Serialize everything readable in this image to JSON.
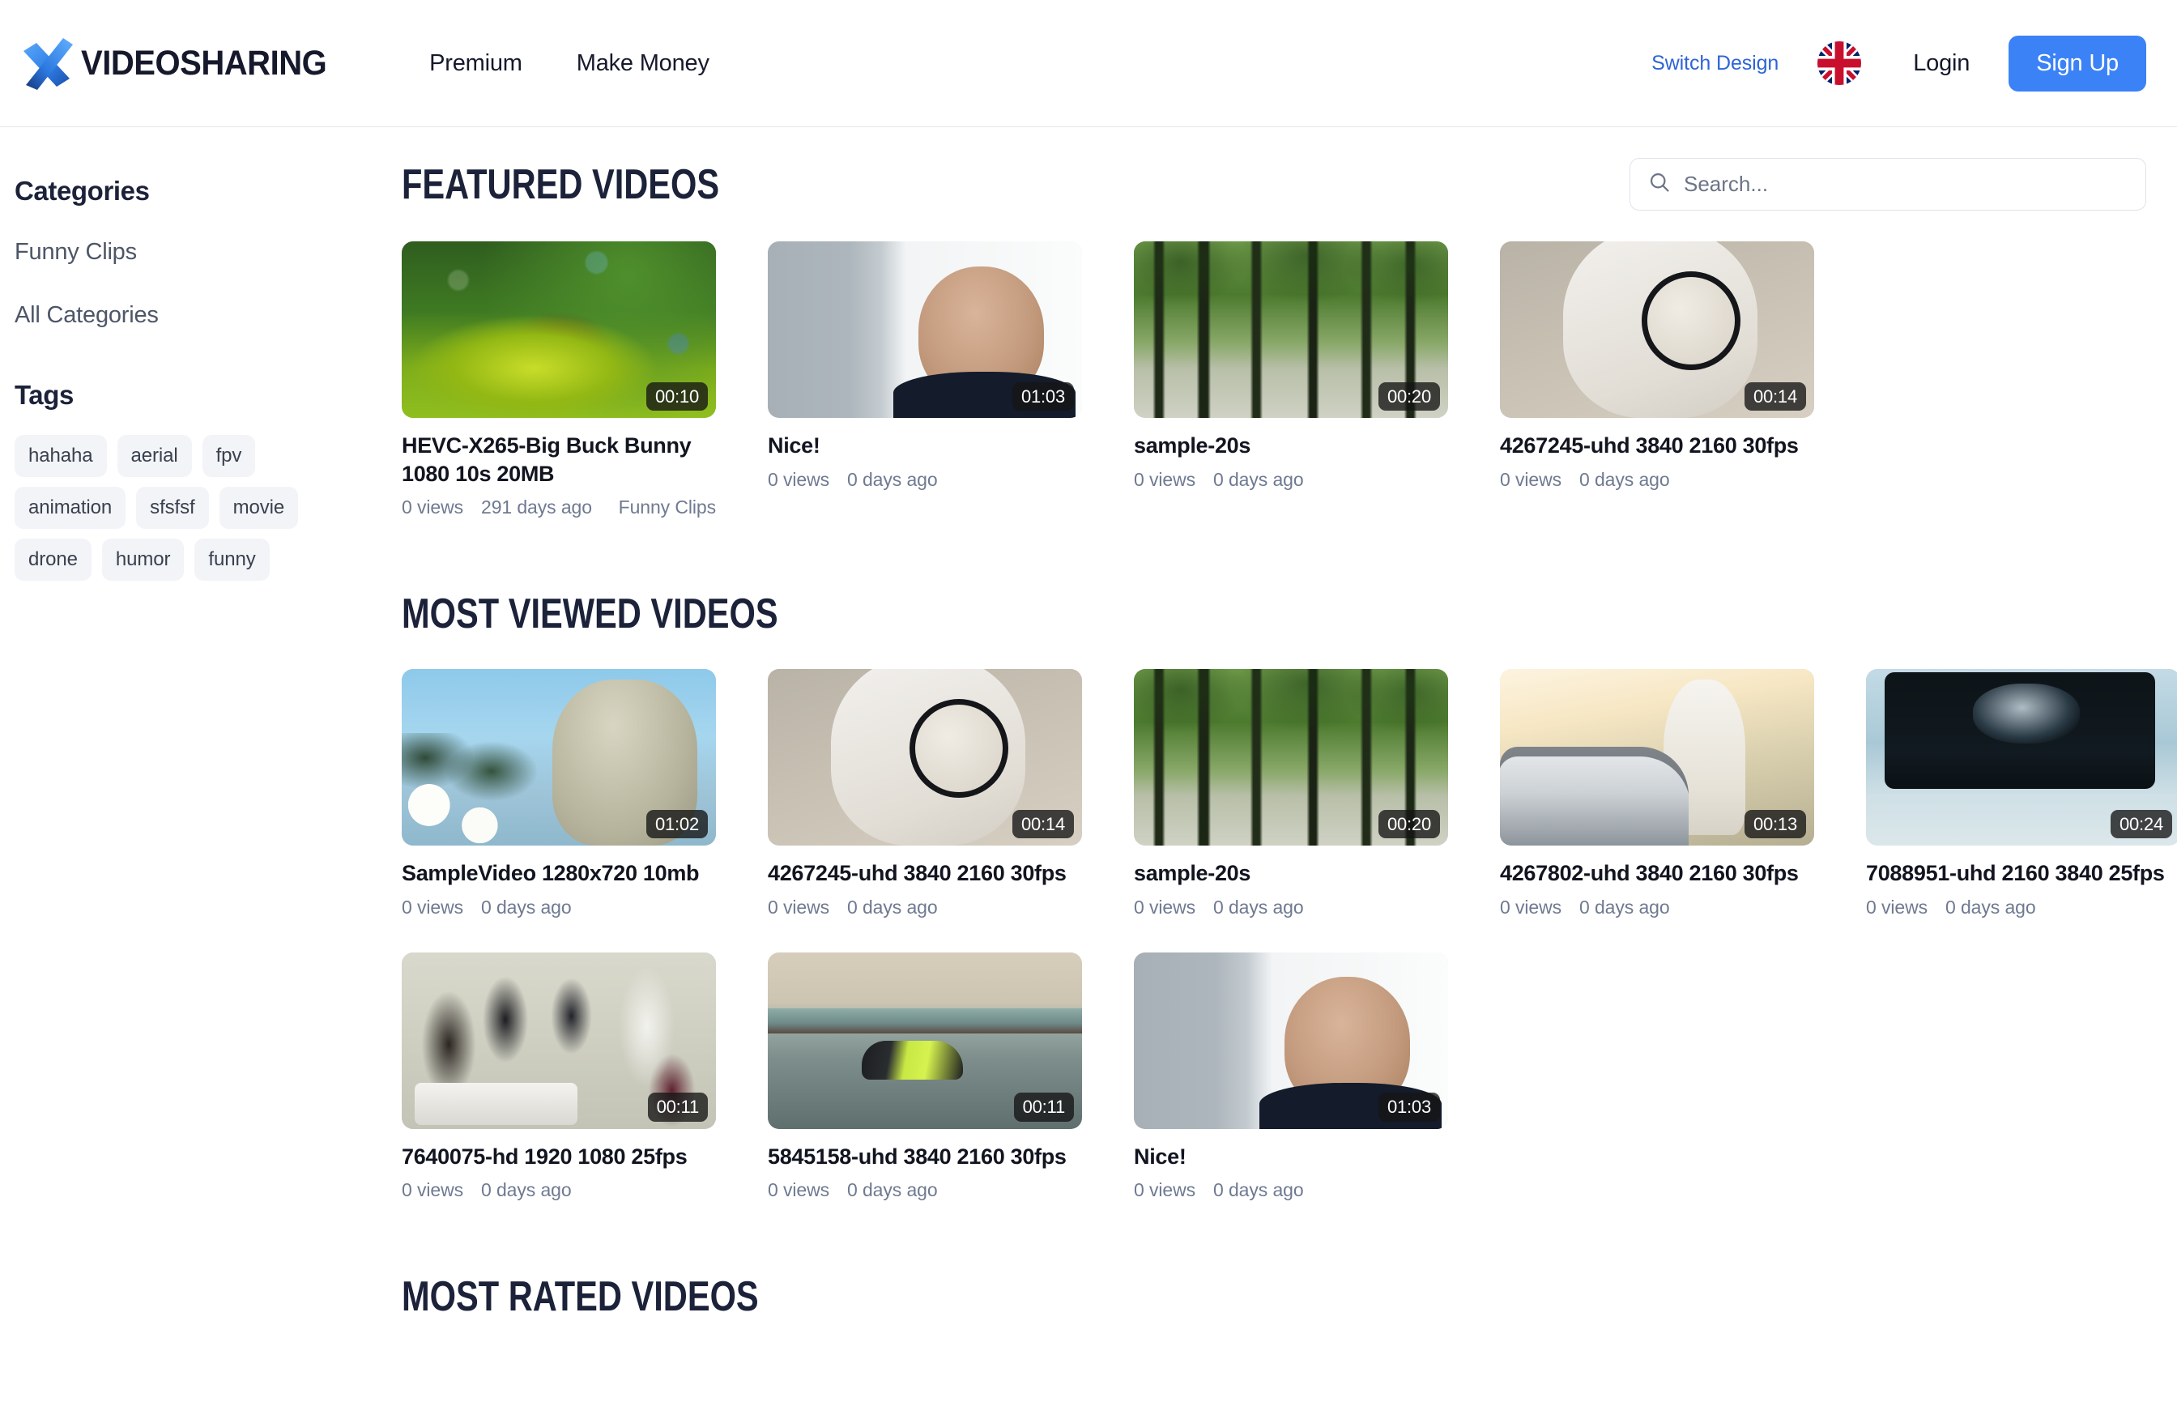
{
  "header": {
    "logo_text": "VIDEOSHARING",
    "logo_icon": "x-logo-icon",
    "nav": [
      {
        "label": "Premium"
      },
      {
        "label": "Make Money"
      }
    ],
    "switch_design": "Switch Design",
    "language_flag": "uk-flag-icon",
    "login": "Login",
    "signup": "Sign Up",
    "accent_color": "#3b82f6",
    "link_color": "#2f64d8"
  },
  "sidebar": {
    "categories_heading": "Categories",
    "categories": [
      {
        "label": "Funny Clips"
      },
      {
        "label": "All Categories"
      }
    ],
    "tags_heading": "Tags",
    "tags": [
      {
        "label": "hahaha"
      },
      {
        "label": "aerial"
      },
      {
        "label": "fpv"
      },
      {
        "label": "animation"
      },
      {
        "label": "sfsfsf"
      },
      {
        "label": "movie"
      },
      {
        "label": "drone"
      },
      {
        "label": "humor"
      },
      {
        "label": "funny"
      }
    ]
  },
  "search": {
    "placeholder": "Search...",
    "value": "",
    "icon": "search-icon"
  },
  "sections": {
    "featured": {
      "title": "FEATURED VIDEOS",
      "videos": [
        {
          "title": "HEVC-X265-Big Buck Bunny 1080 10s 20MB",
          "duration": "00:10",
          "views": "0 views",
          "age": "291 days ago",
          "category": "Funny Clips",
          "art": "art-bunnyforest"
        },
        {
          "title": "Nice!",
          "duration": "01:03",
          "views": "0 views",
          "age": "0 days ago",
          "category": "",
          "art": "art-man"
        },
        {
          "title": "sample-20s",
          "duration": "00:20",
          "views": "0 views",
          "age": "0 days ago",
          "category": "",
          "art": "art-trees"
        },
        {
          "title": "4267245-uhd 3840 2160 30fps",
          "duration": "00:14",
          "views": "0 views",
          "age": "0 days ago",
          "category": "",
          "art": "art-magnifier"
        }
      ]
    },
    "most_viewed": {
      "title": "MOST VIEWED VIDEOS",
      "videos": [
        {
          "title": "SampleVideo 1280x720 10mb",
          "duration": "01:02",
          "views": "0 views",
          "age": "0 days ago",
          "category": "",
          "art": "art-bunnychar"
        },
        {
          "title": "4267245-uhd 3840 2160 30fps",
          "duration": "00:14",
          "views": "0 views",
          "age": "0 days ago",
          "category": "",
          "art": "art-magnifier"
        },
        {
          "title": "sample-20s",
          "duration": "00:20",
          "views": "0 views",
          "age": "0 days ago",
          "category": "",
          "art": "art-trees"
        },
        {
          "title": "4267802-uhd 3840 2160 30fps",
          "duration": "00:13",
          "views": "0 views",
          "age": "0 days ago",
          "category": "",
          "art": "art-car-person"
        },
        {
          "title": "7088951-uhd 2160 3840 25fps",
          "duration": "00:24",
          "views": "0 views",
          "age": "0 days ago",
          "category": "",
          "art": "art-monitor"
        },
        {
          "title": "7640075-hd 1920 1080 25fps",
          "duration": "00:11",
          "views": "0 views",
          "age": "0 days ago",
          "category": "",
          "art": "art-office"
        },
        {
          "title": "5845158-uhd 3840 2160 30fps",
          "duration": "00:11",
          "views": "0 views",
          "age": "0 days ago",
          "category": "",
          "art": "art-sportscar"
        },
        {
          "title": "Nice!",
          "duration": "01:03",
          "views": "0 views",
          "age": "0 days ago",
          "category": "",
          "art": "art-man"
        }
      ]
    },
    "most_rated": {
      "title": "MOST RATED VIDEOS"
    }
  }
}
